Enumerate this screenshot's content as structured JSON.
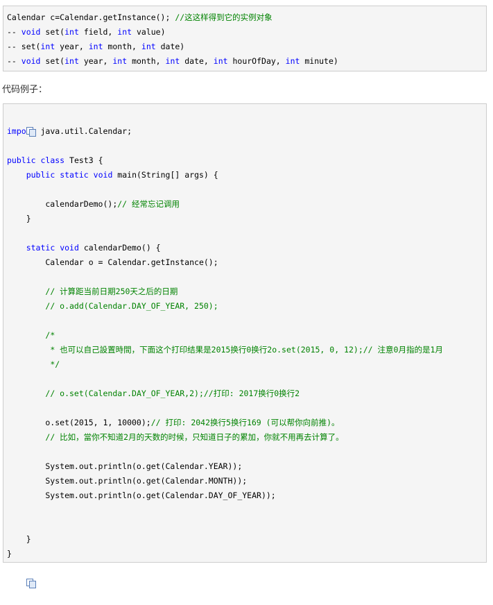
{
  "api_box": {
    "lines": [
      [
        {
          "t": "Calendar c=Calendar.getInstance(); "
        },
        {
          "t": "//这这样得到它的实例对象",
          "c": "cm"
        }
      ],
      [
        {
          "t": "-- "
        },
        {
          "t": "void",
          "c": "kw"
        },
        {
          "t": " set("
        },
        {
          "t": "int",
          "c": "kw"
        },
        {
          "t": " field, "
        },
        {
          "t": "int",
          "c": "kw"
        },
        {
          "t": " value)"
        }
      ],
      [
        {
          "t": "-- set("
        },
        {
          "t": "int",
          "c": "kw"
        },
        {
          "t": " year, "
        },
        {
          "t": "int",
          "c": "kw"
        },
        {
          "t": " month, "
        },
        {
          "t": "int",
          "c": "kw"
        },
        {
          "t": " date)"
        }
      ],
      [
        {
          "t": "-- "
        },
        {
          "t": "void",
          "c": "kw"
        },
        {
          "t": " set("
        },
        {
          "t": "int",
          "c": "kw"
        },
        {
          "t": " year, "
        },
        {
          "t": "int",
          "c": "kw"
        },
        {
          "t": " month, "
        },
        {
          "t": "int",
          "c": "kw"
        },
        {
          "t": " date, "
        },
        {
          "t": "int",
          "c": "kw"
        },
        {
          "t": " hourOfDay, "
        },
        {
          "t": "int",
          "c": "kw"
        },
        {
          "t": " minute)"
        }
      ]
    ]
  },
  "example_label": "代码例子：",
  "icons": {
    "copy_top": "copy-icon",
    "copy_bottom": "copy-icon"
  },
  "code_box": {
    "lines": [
      [
        {
          "t": "import",
          "c": "kw"
        },
        {
          "t": " java.util.Calendar;"
        }
      ],
      [],
      [
        {
          "t": "public",
          "c": "kw"
        },
        {
          "t": " "
        },
        {
          "t": "class",
          "c": "kw"
        },
        {
          "t": " Test3 {"
        }
      ],
      [
        {
          "t": "    "
        },
        {
          "t": "public",
          "c": "kw"
        },
        {
          "t": " "
        },
        {
          "t": "static",
          "c": "kw"
        },
        {
          "t": " "
        },
        {
          "t": "void",
          "c": "kw"
        },
        {
          "t": " main(String[] args) {"
        }
      ],
      [],
      [
        {
          "t": "        calendarDemo();"
        },
        {
          "t": "// 经常忘记调用",
          "c": "cm"
        }
      ],
      [
        {
          "t": "    }"
        }
      ],
      [],
      [
        {
          "t": "    "
        },
        {
          "t": "static",
          "c": "kw"
        },
        {
          "t": " "
        },
        {
          "t": "void",
          "c": "kw"
        },
        {
          "t": " calendarDemo() {"
        }
      ],
      [
        {
          "t": "        Calendar o = Calendar.getInstance();"
        }
      ],
      [],
      [
        {
          "t": "        "
        },
        {
          "t": "// 计算距当前日期250天之后的日期",
          "c": "cm"
        }
      ],
      [
        {
          "t": "        "
        },
        {
          "t": "// o.add(Calendar.DAY_OF_YEAR, 250);",
          "c": "cm"
        }
      ],
      [],
      [
        {
          "t": "        "
        },
        {
          "t": "/*",
          "c": "cm"
        }
      ],
      [
        {
          "t": "         "
        },
        {
          "t": "* 也可以自己設置時間，下面这个打印结果是2015换行0换行2o.set(2015, 0, 12);// 注意0月指的是1月",
          "c": "cm"
        }
      ],
      [
        {
          "t": "         "
        },
        {
          "t": "*/",
          "c": "cm"
        }
      ],
      [],
      [
        {
          "t": "        "
        },
        {
          "t": "// o.set(Calendar.DAY_OF_YEAR,2);//打印: 2017换行0换行2",
          "c": "cm"
        }
      ],
      [],
      [
        {
          "t": "        o.set(2015, 1, 10000);"
        },
        {
          "t": "// 打印: 2042换行5换行169 (可以帮你向前推)。",
          "c": "cm"
        }
      ],
      [
        {
          "t": "        "
        },
        {
          "t": "// 比如，當你不知道2月的天数的时候，只知道日子的累加，你就不用再去计算了。",
          "c": "cm"
        }
      ],
      [],
      [
        {
          "t": "        System.out.println(o.get(Calendar.YEAR));"
        }
      ],
      [
        {
          "t": "        System.out.println(o.get(Calendar.MONTH));"
        }
      ],
      [
        {
          "t": "        System.out.println(o.get(Calendar.DAY_OF_YEAR));"
        }
      ],
      [],
      [],
      [
        {
          "t": "    }"
        }
      ],
      [
        {
          "t": "}"
        }
      ]
    ]
  }
}
